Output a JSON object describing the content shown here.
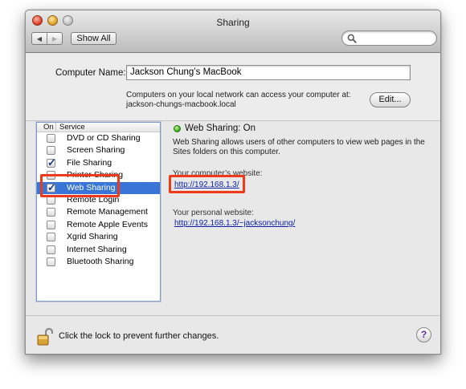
{
  "window": {
    "title": "Sharing"
  },
  "toolbar": {
    "back_icon": "chevron-left-icon",
    "forward_icon": "chevron-right-icon",
    "show_all_label": "Show All",
    "search_placeholder": "",
    "search_icon": "search-icon"
  },
  "computer": {
    "label": "Computer Name:",
    "name": "Jackson Chung’s MacBook",
    "info_line1": "Computers on your local network can access your computer at:",
    "info_line2": "jackson-chungs-macbook.local",
    "edit_label": "Edit..."
  },
  "services": {
    "header_on": "On",
    "header_service": "Service",
    "items": [
      {
        "label": "DVD or CD Sharing",
        "checked": false,
        "selected": false
      },
      {
        "label": "Screen Sharing",
        "checked": false,
        "selected": false
      },
      {
        "label": "File Sharing",
        "checked": true,
        "selected": false
      },
      {
        "label": "Printer Sharing",
        "checked": false,
        "selected": false
      },
      {
        "label": "Web Sharing",
        "checked": true,
        "selected": true
      },
      {
        "label": "Remote Login",
        "checked": false,
        "selected": false
      },
      {
        "label": "Remote Management",
        "checked": false,
        "selected": false
      },
      {
        "label": "Remote Apple Events",
        "checked": false,
        "selected": false
      },
      {
        "label": "Xgrid Sharing",
        "checked": false,
        "selected": false
      },
      {
        "label": "Internet Sharing",
        "checked": false,
        "selected": false
      },
      {
        "label": "Bluetooth Sharing",
        "checked": false,
        "selected": false
      }
    ]
  },
  "detail": {
    "status": "Web Sharing: On",
    "status_color": "#3eb21c",
    "description": "Web Sharing allows users of other computers to view web pages in the Sites folders on this computer.",
    "site_label": "Your computer’s website:",
    "site_url": "http://192.168.1.3/",
    "personal_label": "Your personal website:",
    "personal_url": "http://192.168.1.3/~jacksonchung/"
  },
  "footer": {
    "lock_icon": "lock-open-icon",
    "lock_text": "Click the lock to prevent further changes.",
    "help_label": "?"
  },
  "colors": {
    "selection": "#3875d7",
    "highlight": "#ee3a1a",
    "link": "#0a1fa8"
  }
}
